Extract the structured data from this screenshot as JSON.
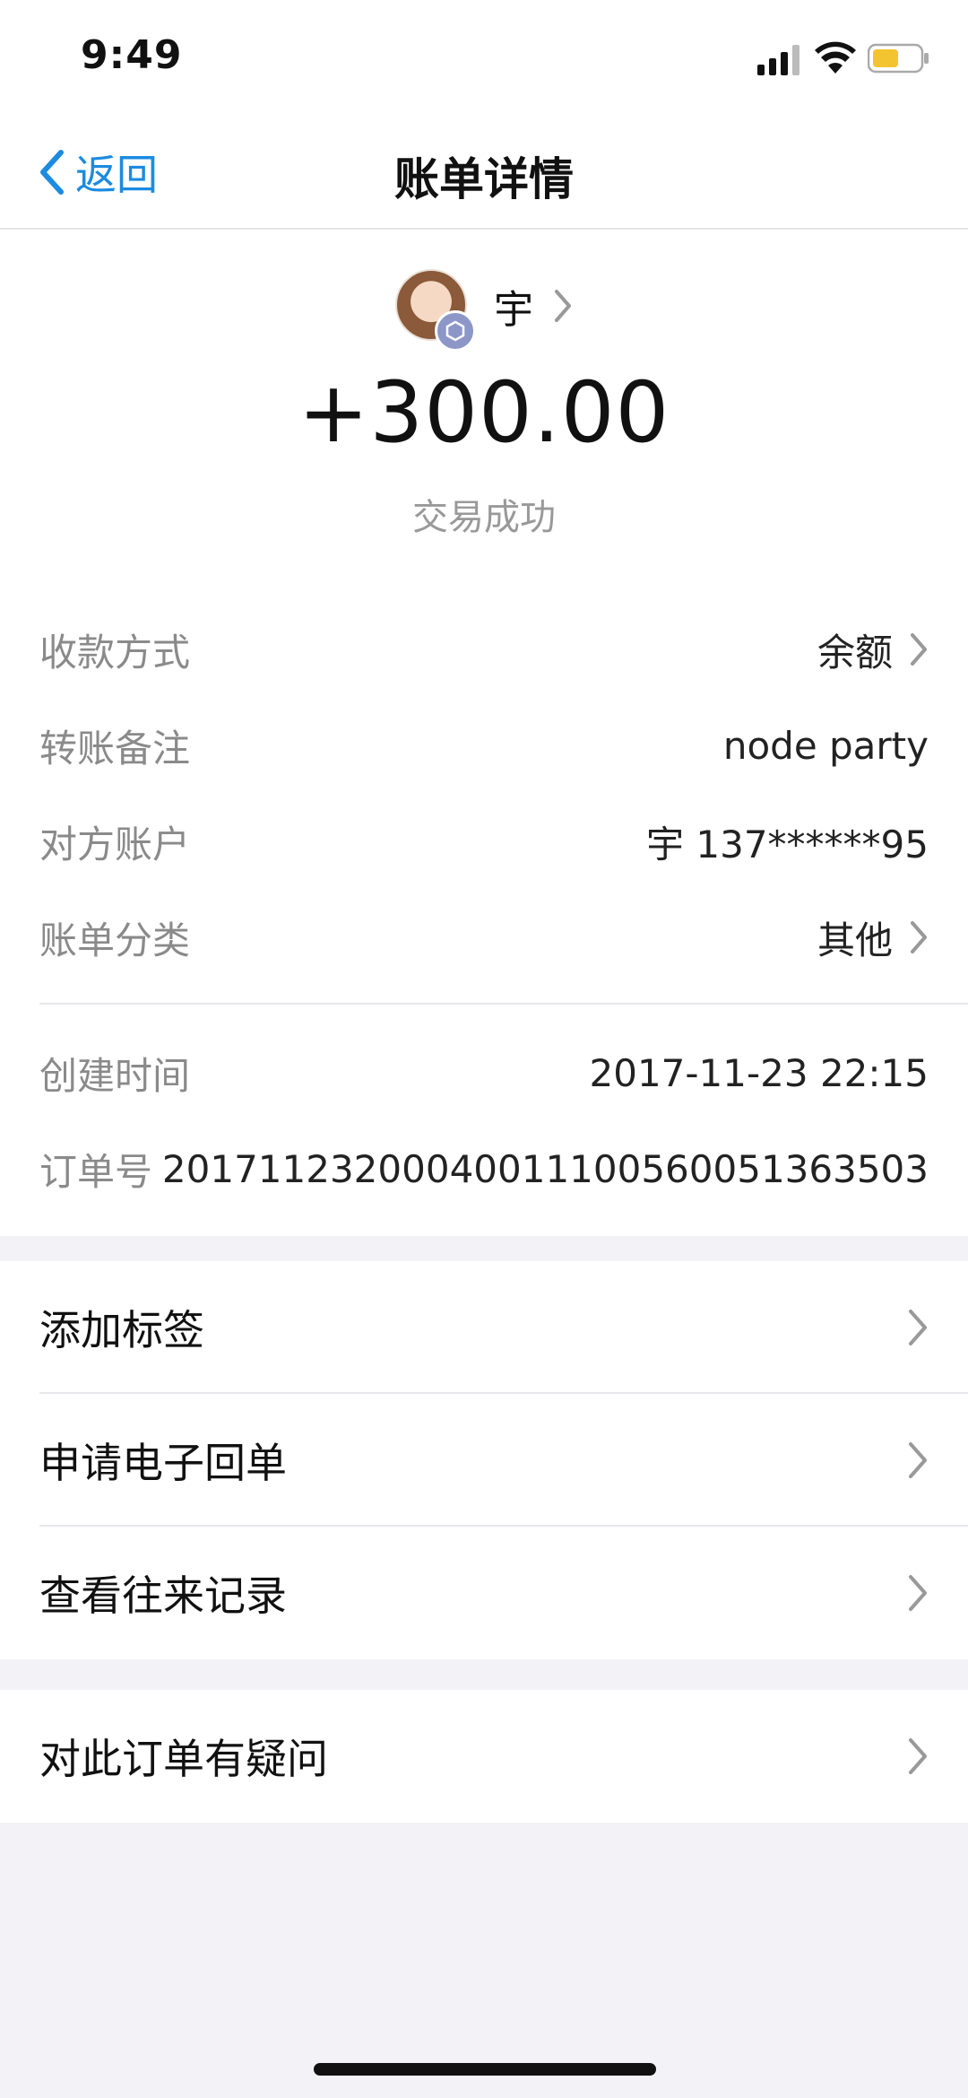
{
  "status_bar": {
    "time": "9:49"
  },
  "nav": {
    "back_label": "返回",
    "title": "账单详情"
  },
  "header": {
    "payer_name": "宇",
    "amount": "+300.00",
    "status": "交易成功"
  },
  "details": [
    {
      "label": "收款方式",
      "value": "余额",
      "has_arrow": true
    },
    {
      "label": "转账备注",
      "value": "node party",
      "has_arrow": false
    },
    {
      "label": "对方账户",
      "value": "宇 137******95",
      "has_arrow": false
    },
    {
      "label": "账单分类",
      "value": "其他",
      "has_arrow": true
    }
  ],
  "meta": [
    {
      "label": "创建时间",
      "value": "2017-11-23 22:15"
    },
    {
      "label": "订单号",
      "value": "20171123200040011100560051363503"
    }
  ],
  "actions": [
    {
      "label": "添加标签"
    },
    {
      "label": "申请电子回单"
    },
    {
      "label": "查看往来记录"
    }
  ],
  "support": {
    "label": "对此订单有疑问"
  },
  "colors": {
    "accent": "#1c8be0",
    "background": "#f2f2f7",
    "battery": "#f4c430"
  }
}
